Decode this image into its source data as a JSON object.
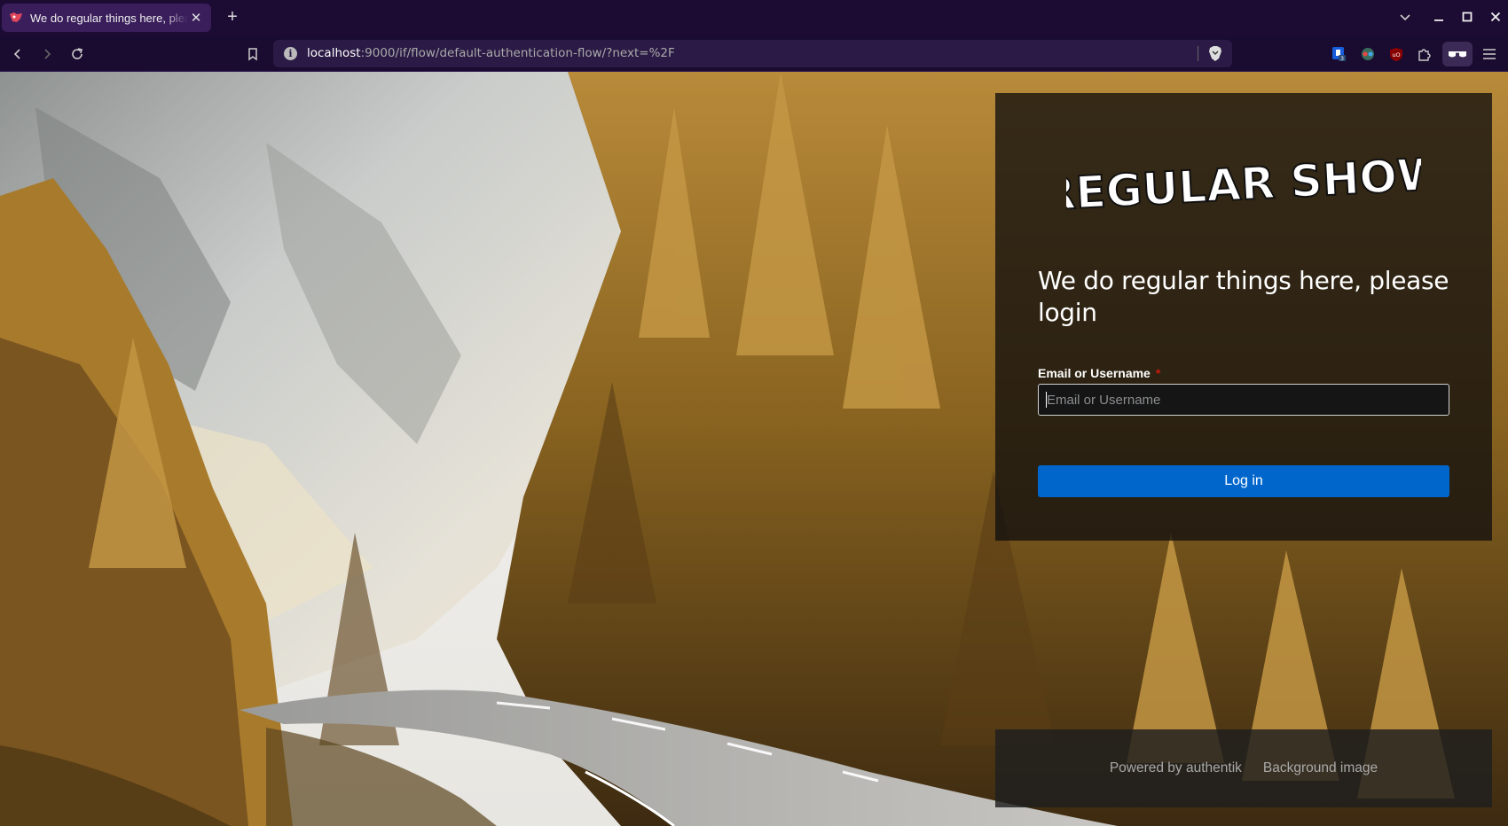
{
  "browser": {
    "tab_title": "We do regular things here, please login",
    "url_host": "localhost",
    "url_rest": ":9000/if/flow/default-authentication-flow/?next=%2F",
    "extension_badge": "3",
    "accent": "#1c0b33"
  },
  "login": {
    "brand": "REGULAR SHOW",
    "heading": "We do regular things here, please login",
    "field_label": "Email or Username",
    "required_mark": "*",
    "placeholder": "Email or Username",
    "button_label": "Log in",
    "button_color": "#0066cc"
  },
  "footer": {
    "powered_by": "Powered by authentik",
    "background_link": "Background image"
  }
}
